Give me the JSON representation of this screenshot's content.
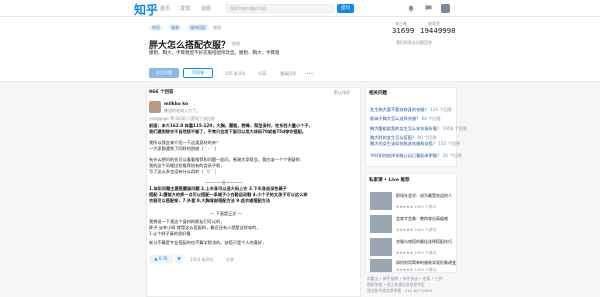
{
  "topbar": {
    "logo": "知乎",
    "nav": [
      "首页",
      "发现",
      "话题"
    ],
    "search_placeholder": "搜索你感兴趣的内容...",
    "ask_label": "提问"
  },
  "question": {
    "tags": [
      "穿搭",
      "服装",
      "服饰搭配"
    ],
    "edit_tags": "修改",
    "title": "胖大怎么搭配衣服？",
    "title_edit": "修改",
    "detail": "腰粗、胸大、手臂粗配不好衣服搭配修改显。腰粗、胸大、手臂粗",
    "follow_label": "关注问题",
    "answer_label": "写回答",
    "comments": "105 条评论",
    "share": "分享",
    "invite": "邀请回答",
    "more": "•••",
    "stats": {
      "followers_label": "关注者",
      "followers": "31699",
      "views_label": "被浏览",
      "views": "19449998"
    },
    "related_link": "我们的胖友问题回答"
  },
  "answers": {
    "count": "966 个回答",
    "sort": "默认排序",
    "author": "milkko ko",
    "author_bio": "集团的老城入力了。",
    "agreed": "yonggege 等 6636 人赞同了该回答",
    "lines": [
      "前面：本大162.8 体重115-120，大胸，腰粗，胯骨，梨型身材，吃东西大量小个子，",
      "我们遇到穿衣不自然很不够了，平常只会用下面可以用大体码70或者75d穿衣搭配。",
      "我所以我会来介绍一下这类身材的亲！",
      "一大家都遇到了同样的困惑（ ` - ` ）",
      "",
      "有什么想问的也可以看看推荐和问题一起问，感谢大家帮会，我应该一个个答疑的",
      "我的这个风格比较推荐给有的女孩子呢，",
      "写了这么多也没有什么用的（´ ▽ ` ）",
      "————分————",
      "1.体形问题主要是腰部问题 2.上半身可以选大码上衣 3.下半身选深色裤子",
      "搭配 3.腰部大的胖一点可以搭配一条裙子小白鞋运动鞋 4.小个子的女孩子可以这么穿",
      "衣服可以搭配穿，7.外套 8.大胸背部搭配方法 9.连衣裙搭配方法",
      "",
      "— 下面是正文 —",
      "我想说一下我这个身材的胖友们可以的，",
      "胖子 @李小萌 就是这么搭配的，最近还有人就是这样穿的，",
      "1.让个胖子真的很好看",
      "老公不算是专业搭配的也不算学院派的。穿搭只是个人的喜好，"
    ],
    "vote": "6.7K",
    "comment_count": "1054 条评论",
    "ans_share": "分享"
  },
  "sidebar": {
    "related_title": "相关问题",
    "related": [
      {
        "text": "女生胸大要不要穿修身的衣服？",
        "count": "135 个回答"
      },
      {
        "text": "胖妹子胸大怎么选择衣服？",
        "count": "68 个回答"
      },
      {
        "text": "胸大腰粗肩宽的女生怎么穿衣服好看？",
        "count": "1958 个回答"
      },
      {
        "text": "胸大胖的女生怎么搭配？",
        "count": "80 个回答"
      },
      {
        "text": "胸大的女生该如何挑选衣服和穿搭？",
        "count": "155 个回答"
      },
      {
        "text": "平时如何选择衣服让自己看起来更瘦？",
        "count": "36 个回答"
      }
    ],
    "live_title": "私家课 • Live 推荐",
    "lives": [
      {
        "title": "职场社会学：成为最受欢迎的人",
        "sub": "★★★★★ 1093 人参与"
      },
      {
        "title": "会穿才会美：教你穿出高级感",
        "sub": "★★★★★ 1000 人参与"
      },
      {
        "title": "衣服与穿搭的最佳选择搭配技巧",
        "sub": "★★★★★ 1000 人参与"
      },
      {
        "title": "如何利用简单的服装实现形象改变",
        "sub": "★★★★★ 1000 人参与"
      }
    ],
    "footer": [
      "刘看山 • 知乎指南 • 知乎协议 • 应用 • 工作",
      "侵权举报 • 网上有害信息举报专区",
      "违法和不良信息举报：010-82716601"
    ]
  },
  "colors": {
    "brand": "#0f88eb",
    "link": "#175199"
  }
}
